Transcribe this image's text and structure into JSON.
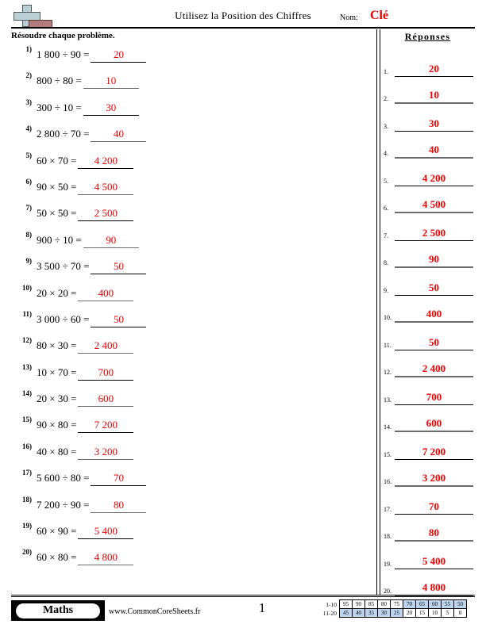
{
  "header": {
    "logo_icon": "plus-blocks-logo",
    "title": "Utilisez la Position des Chiffres",
    "name_label": "Nom:",
    "name_value": "Clé"
  },
  "instruction": "Résoudre chaque problème.",
  "answers_header": "Réponses",
  "problems": [
    {
      "num": "1)",
      "text": "1 800 ÷ 90 =",
      "answer": "20"
    },
    {
      "num": "2)",
      "text": "800 ÷ 80 =",
      "answer": "10"
    },
    {
      "num": "3)",
      "text": "300 ÷ 10 =",
      "answer": "30"
    },
    {
      "num": "4)",
      "text": "2 800 ÷ 70 =",
      "answer": "40"
    },
    {
      "num": "5)",
      "text": "60 × 70 =",
      "answer": "4 200"
    },
    {
      "num": "6)",
      "text": "90 × 50 =",
      "answer": "4 500"
    },
    {
      "num": "7)",
      "text": "50 × 50 =",
      "answer": "2 500"
    },
    {
      "num": "8)",
      "text": "900 ÷ 10 =",
      "answer": "90"
    },
    {
      "num": "9)",
      "text": "3 500 ÷ 70 =",
      "answer": "50"
    },
    {
      "num": "10)",
      "text": "20 × 20 =",
      "answer": "400"
    },
    {
      "num": "11)",
      "text": "3 000 ÷ 60 =",
      "answer": "50"
    },
    {
      "num": "12)",
      "text": "80 × 30 =",
      "answer": "2 400"
    },
    {
      "num": "13)",
      "text": "10 × 70 =",
      "answer": "700"
    },
    {
      "num": "14)",
      "text": "20 × 30 =",
      "answer": "600"
    },
    {
      "num": "15)",
      "text": "90 × 80 =",
      "answer": "7 200"
    },
    {
      "num": "16)",
      "text": "40 × 80 =",
      "answer": "3 200"
    },
    {
      "num": "17)",
      "text": "5 600 ÷ 80 =",
      "answer": "70"
    },
    {
      "num": "18)",
      "text": "7 200 ÷ 90 =",
      "answer": "80"
    },
    {
      "num": "19)",
      "text": "60 × 90 =",
      "answer": "5 400"
    },
    {
      "num": "20)",
      "text": "60 × 80 =",
      "answer": "4 800"
    }
  ],
  "answer_list": [
    {
      "idx": "1.",
      "value": "20"
    },
    {
      "idx": "2.",
      "value": "10"
    },
    {
      "idx": "3.",
      "value": "30"
    },
    {
      "idx": "4.",
      "value": "40"
    },
    {
      "idx": "5.",
      "value": "4 200"
    },
    {
      "idx": "6.",
      "value": "4 500"
    },
    {
      "idx": "7.",
      "value": "2 500"
    },
    {
      "idx": "8.",
      "value": "90"
    },
    {
      "idx": "9.",
      "value": "50"
    },
    {
      "idx": "10.",
      "value": "400"
    },
    {
      "idx": "11.",
      "value": "50"
    },
    {
      "idx": "12.",
      "value": "2 400"
    },
    {
      "idx": "13.",
      "value": "700"
    },
    {
      "idx": "14.",
      "value": "600"
    },
    {
      "idx": "15.",
      "value": "7 200"
    },
    {
      "idx": "16.",
      "value": "3 200"
    },
    {
      "idx": "17.",
      "value": "70"
    },
    {
      "idx": "18.",
      "value": "80"
    },
    {
      "idx": "19.",
      "value": "5 400"
    },
    {
      "idx": "20.",
      "value": "4 800"
    }
  ],
  "footer": {
    "subject_badge": "Maths",
    "site_url": "www.CommonCoreSheets.fr",
    "page_number": "1",
    "score_table": {
      "row1_label": "1-10",
      "row2_label": "11-20",
      "row1": [
        {
          "v": "95",
          "hl": false
        },
        {
          "v": "90",
          "hl": false
        },
        {
          "v": "85",
          "hl": false
        },
        {
          "v": "80",
          "hl": false
        },
        {
          "v": "75",
          "hl": false
        },
        {
          "v": "70",
          "hl": true
        },
        {
          "v": "65",
          "hl": true
        },
        {
          "v": "60",
          "hl": true
        },
        {
          "v": "55",
          "hl": true
        },
        {
          "v": "50",
          "hl": true
        }
      ],
      "row2": [
        {
          "v": "45",
          "hl": true
        },
        {
          "v": "40",
          "hl": true
        },
        {
          "v": "35",
          "hl": true
        },
        {
          "v": "30",
          "hl": true
        },
        {
          "v": "25",
          "hl": true
        },
        {
          "v": "20",
          "hl": false
        },
        {
          "v": "15",
          "hl": false
        },
        {
          "v": "10",
          "hl": false
        },
        {
          "v": "5",
          "hl": false
        },
        {
          "v": "0",
          "hl": false
        }
      ]
    }
  },
  "colors": {
    "answer_red": "#ee0000",
    "highlight_blue": "#bcd4ee",
    "logo_blue": "#b9cfd4",
    "logo_red": "#b37c7c"
  }
}
